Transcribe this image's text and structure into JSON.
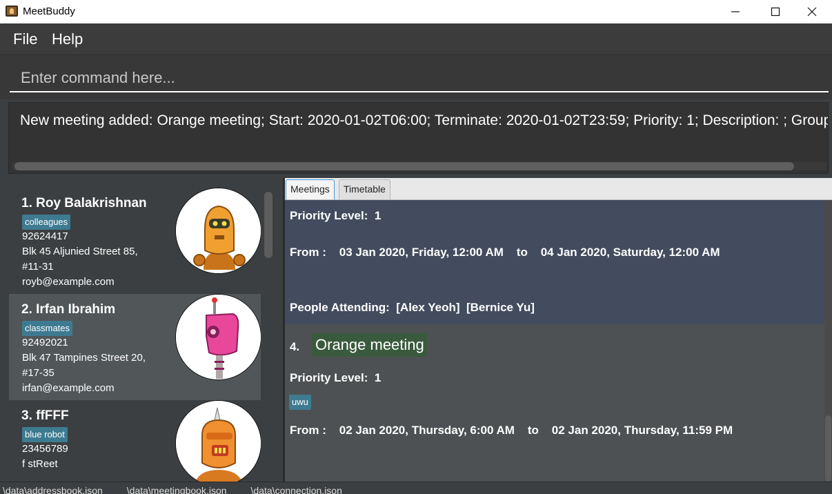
{
  "window": {
    "title": "MeetBuddy",
    "controls": [
      "minimize",
      "maximize",
      "close"
    ]
  },
  "menu": {
    "file": "File",
    "help": "Help"
  },
  "command": {
    "placeholder": "Enter command here..."
  },
  "result": {
    "text": "New meeting added: Orange meeting; Start: 2020-01-02T06:00; Terminate: 2020-01-02T23:59; Priority: 1; Description: ; Groups: [uwu]"
  },
  "persons": [
    {
      "index_name": "1.  Roy Balakrishnan",
      "tag": "colleagues",
      "phone": "92624417",
      "address1": "Blk 45 Aljunied Street 85,",
      "address2": "#11-31",
      "email": "royb@example.com",
      "avatar_color": "#e8922a"
    },
    {
      "index_name": "2.  Irfan Ibrahim",
      "tag": "classmates",
      "phone": "92492021",
      "address1": "Blk 47 Tampines Street 20,",
      "address2": "#17-35",
      "email": "irfan@example.com",
      "avatar_color": "#e8479a"
    },
    {
      "index_name": "3.  ffFFF",
      "tag": "blue robot",
      "phone": "23456789",
      "address1": "f stReet",
      "address2": "",
      "email": "",
      "avatar_color": "#e8922a"
    }
  ],
  "tabs": {
    "meetings": "Meetings",
    "timetable": "Timetable"
  },
  "meeting_previous": {
    "priority": "Priority Level:  1",
    "from_line": "From :    03 Jan 2020, Friday, 12:00 AM    to    04 Jan 2020, Saturday, 12:00 AM",
    "people": "People Attending:  [Alex Yeoh]  [Bernice Yu]"
  },
  "meeting_current": {
    "index": "4.",
    "title": "Orange meeting",
    "priority": "Priority Level:  1",
    "tag": "uwu",
    "from_line": "From :    02 Jan 2020, Thursday, 6:00 AM    to    02 Jan 2020, Thursday, 11:59 PM"
  },
  "status": {
    "text": "\\data\\addressbook.json         \\data\\meetingbook.json         \\data\\connection.json"
  }
}
